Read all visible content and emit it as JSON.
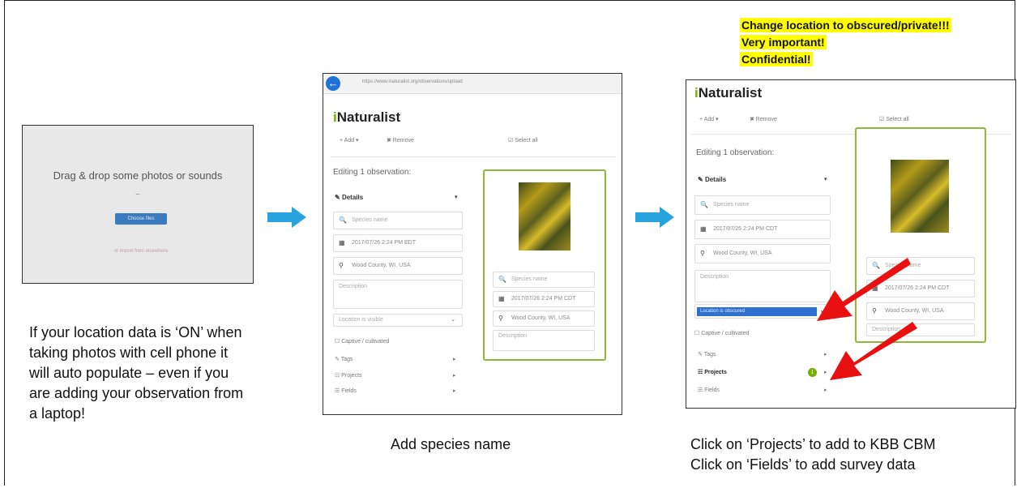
{
  "panel1": {
    "drag_text": "Drag & drop some photos or sounds",
    "or_text": "~",
    "choose_button": "Choose files",
    "link_text": "or import from elsewhere"
  },
  "panel2": {
    "url": "https://www.inaturalist.org/observations/upload",
    "brand_i": "i",
    "brand_rest": "Naturalist",
    "toolbar": {
      "add": "+ Add ▾",
      "remove": "✖ Remove",
      "select_all": "Select all"
    },
    "editing": "Editing 1 observation:",
    "details": "Details",
    "species_placeholder": "Species name",
    "date": "2017/07/26 2:24 PM EDT",
    "location": "Wood County, WI, USA",
    "description_placeholder": "Description",
    "geoprivacy": "Location is visible",
    "captive": "Captive / cultivated",
    "tags": "Tags",
    "projects": "Projects",
    "fields": "Fields",
    "card_date": "2017/07/26 2:24 PM CDT",
    "card_location": "Wood County, WI, USA",
    "card_search": "Species name",
    "card_desc": "Description"
  },
  "panel3": {
    "brand_i": "i",
    "brand_rest": "Naturalist",
    "toolbar": {
      "add": "+ Add ▾",
      "remove": "✖ Remove",
      "select_all": "Select all"
    },
    "editing": "Editing 1 observation:",
    "details": "Details",
    "species_placeholder": "Species name",
    "date": "2017/07/26 2:24 PM CDT",
    "location": "Wood County, WI, USA",
    "description_placeholder": "Description",
    "geoprivacy_selected": "Location is obscured",
    "captive": "Captive / cultivated",
    "tags": "Tags",
    "projects": "Projects",
    "projects_count": "1",
    "fields": "Fields",
    "card_search": "Species name",
    "card_date": "2017/07/26 2:24 PM CDT",
    "card_location": "Wood County, WI, USA",
    "card_desc": "Description"
  },
  "notes": {
    "line1": "Change location to obscured/private!!!",
    "line2": "Very important!",
    "line3": "Confidential!"
  },
  "captions": {
    "left": [
      "If your location data is ‘ON’ when",
      "taking photos with cell phone it",
      "will auto populate – even if you",
      "are adding your observation from",
      "a laptop!"
    ],
    "middle": "Add species name",
    "right": [
      "Click on ‘Projects’ to add to KBB CBM",
      "Click on ‘Fields’ to add survey data"
    ]
  },
  "colors": {
    "arrow_blue": "#29a3e0",
    "arrow_red": "#e81010",
    "inat_green": "#74ac00",
    "highlight": "#ffff00"
  }
}
